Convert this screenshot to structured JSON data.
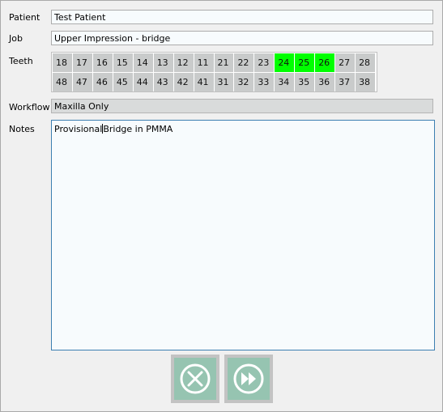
{
  "form": {
    "patient_label": "Patient",
    "patient_value": "Test Patient",
    "job_label": "Job",
    "job_value": "Upper Impression - bridge",
    "teeth_label": "Teeth",
    "workflow_label": "Workflow",
    "workflow_value": "Maxilla Only",
    "notes_label": "Notes",
    "notes_before_caret": "Provisional",
    "notes_after_caret": "Bridge in PMMA"
  },
  "teeth": {
    "upper": [
      {
        "number": "18",
        "selected": false
      },
      {
        "number": "17",
        "selected": false
      },
      {
        "number": "16",
        "selected": false
      },
      {
        "number": "15",
        "selected": false
      },
      {
        "number": "14",
        "selected": false
      },
      {
        "number": "13",
        "selected": false
      },
      {
        "number": "12",
        "selected": false
      },
      {
        "number": "11",
        "selected": false
      },
      {
        "number": "21",
        "selected": false
      },
      {
        "number": "22",
        "selected": false
      },
      {
        "number": "23",
        "selected": false
      },
      {
        "number": "24",
        "selected": true
      },
      {
        "number": "25",
        "selected": true
      },
      {
        "number": "26",
        "selected": true
      },
      {
        "number": "27",
        "selected": false
      },
      {
        "number": "28",
        "selected": false
      }
    ],
    "lower": [
      {
        "number": "48",
        "selected": false
      },
      {
        "number": "47",
        "selected": false
      },
      {
        "number": "46",
        "selected": false
      },
      {
        "number": "45",
        "selected": false
      },
      {
        "number": "44",
        "selected": false
      },
      {
        "number": "43",
        "selected": false
      },
      {
        "number": "42",
        "selected": false
      },
      {
        "number": "41",
        "selected": false
      },
      {
        "number": "31",
        "selected": false
      },
      {
        "number": "32",
        "selected": false
      },
      {
        "number": "33",
        "selected": false
      },
      {
        "number": "34",
        "selected": false
      },
      {
        "number": "35",
        "selected": false
      },
      {
        "number": "36",
        "selected": false
      },
      {
        "number": "37",
        "selected": false
      },
      {
        "number": "38",
        "selected": false
      }
    ],
    "selected_color": "#00ff00",
    "unselected_color": "#c9cbcb"
  },
  "buttons": {
    "cancel_icon": "close-circle-icon",
    "next_icon": "fast-forward-circle-icon",
    "button_color": "#96c4b1",
    "icon_color": "#ffffff"
  }
}
